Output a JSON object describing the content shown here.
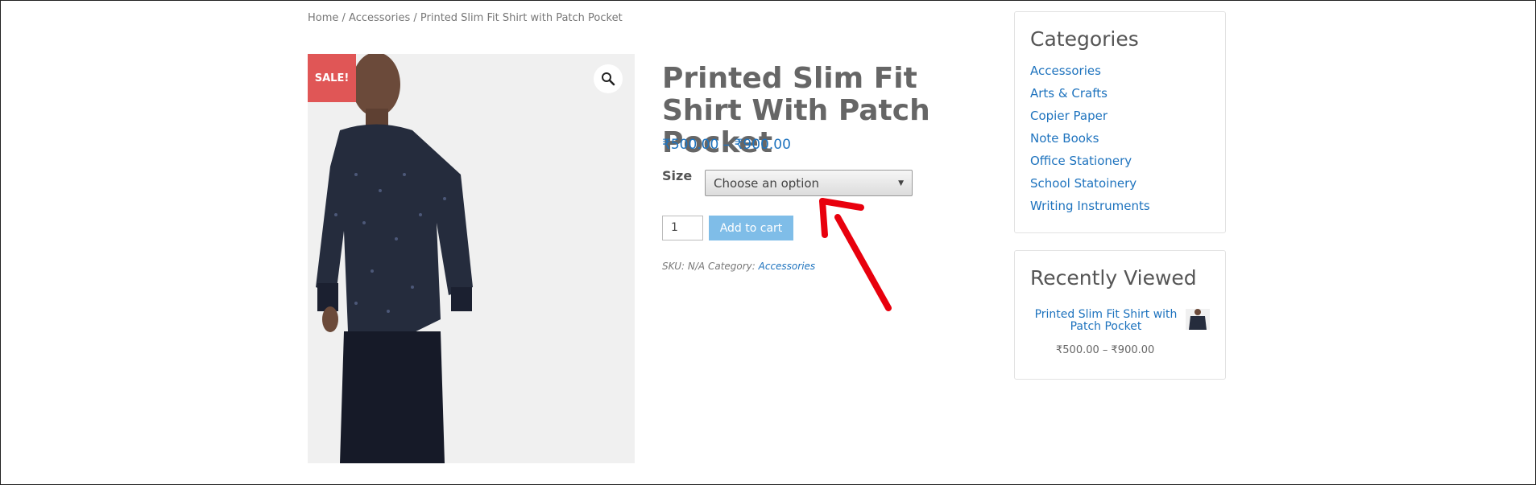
{
  "breadcrumb": {
    "home": "Home",
    "sep1": " / ",
    "category": "Accessories",
    "sep2": " / ",
    "current": "Printed Slim Fit Shirt with Patch Pocket"
  },
  "product": {
    "sale_badge": "SALE!",
    "title": "Printed Slim Fit Shirt With Patch Pocket",
    "price": "₹500.00 – ₹900.00",
    "size_label": "Size",
    "size_selected": "Choose an option",
    "quantity": "1",
    "add_to_cart": "Add to cart",
    "meta_prefix": "SKU: N/A Category: ",
    "meta_category": "Accessories",
    "zoom_icon": "magnifier-icon"
  },
  "sidebar": {
    "categories_title": "Categories",
    "categories": [
      "Accessories",
      "Arts & Crafts",
      "Copier Paper",
      "Note Books",
      "Office Stationery",
      "School Statoinery",
      "Writing Instruments"
    ],
    "recent_title": "Recently Viewed",
    "recent_item": {
      "name": "Printed Slim Fit Shirt with Patch Pocket",
      "price": "₹500.00 – ₹900.00"
    }
  },
  "colors": {
    "link": "#1e73be",
    "sale": "#e05656",
    "button": "#7fbde8",
    "annotation_arrow": "#e8000d"
  }
}
